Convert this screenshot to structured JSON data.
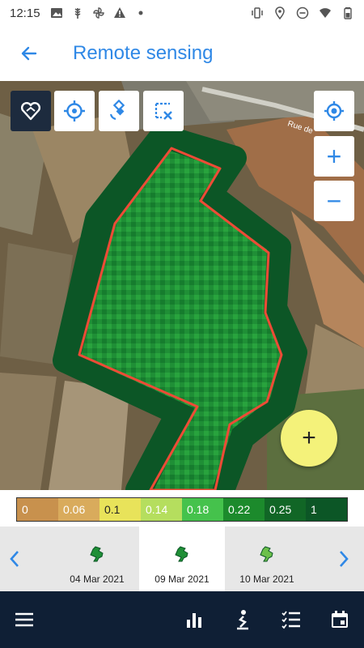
{
  "status_bar": {
    "time": "12:15",
    "left_icons": [
      "image-icon",
      "wheat-icon",
      "pinwheel-icon",
      "warning-icon",
      "dot-icon"
    ],
    "right_icons": [
      "vibrate-icon",
      "location-icon",
      "dnd-icon",
      "wifi-icon",
      "battery-icon"
    ]
  },
  "app_bar": {
    "title": "Remote sensing",
    "back_icon": "arrow-left-icon"
  },
  "map": {
    "road_label": "Rue de",
    "tools": [
      {
        "name": "field-outline-tool",
        "icon": "heart-field-icon",
        "active": true
      },
      {
        "name": "target-tool",
        "icon": "crosshair-icon",
        "active": false
      },
      {
        "name": "satellite-tool",
        "icon": "satellite-icon",
        "active": false
      },
      {
        "name": "clear-selection-tool",
        "icon": "clear-selection-icon",
        "active": false
      }
    ],
    "controls": {
      "locate_icon": "locate-icon",
      "zoom_in": "+",
      "zoom_out": "−"
    },
    "fab_label": "+"
  },
  "legend": {
    "colors": [
      "#c8914d",
      "#d9ab5c",
      "#e8e35a",
      "#b5de5e",
      "#45c24c",
      "#1c8a2c",
      "#116626",
      "#0c5626"
    ],
    "labels": [
      "0",
      "0.06",
      "0.1",
      "0.14",
      "0.18",
      "0.22",
      "0.25",
      "1"
    ],
    "label_colors": [
      "#fff",
      "#fff",
      "#222",
      "#fff",
      "#fff",
      "#fff",
      "#fff",
      "#fff"
    ]
  },
  "timeline": {
    "prev_icon": "chevron-left-icon",
    "next_icon": "chevron-right-icon",
    "dates": [
      {
        "label": "04 Mar 2021",
        "selected": false
      },
      {
        "label": "09 Mar 2021",
        "selected": true
      },
      {
        "label": "10 Mar 2021",
        "selected": false
      }
    ]
  },
  "bottom_nav": {
    "items": [
      "menu-icon",
      "bar-chart-icon",
      "sampling-icon",
      "list-icon",
      "calendar-icon"
    ]
  }
}
